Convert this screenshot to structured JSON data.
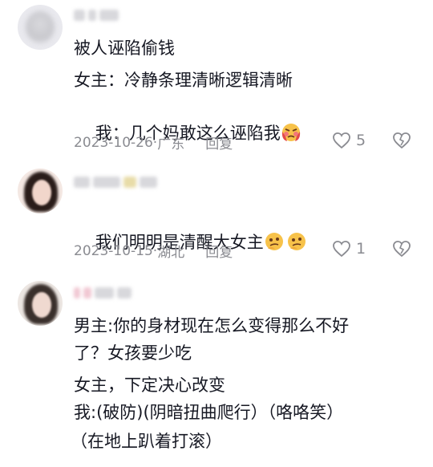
{
  "comments": [
    {
      "lines": [
        "被人诬陷偷钱",
        "女主：冷静条理清晰逻辑清晰",
        "我：几个妈敢这么诬陷我"
      ],
      "date": "2023-10-26",
      "location": "广东",
      "reply_label": "回复",
      "like_count": "5",
      "emoji": "angry-face-emoji"
    },
    {
      "lines": [
        "我们明明是清醒大女主"
      ],
      "date": "2023-10-15",
      "location": "湖北",
      "reply_label": "回复",
      "like_count": "1",
      "emoji": "thinking-face-emoji"
    },
    {
      "lines": [
        "男主:你的身材现在怎么变得那么不好",
        "了？女孩要少吃",
        "女主，下定决心改变",
        "我:(破防)(阴暗扭曲爬行）（咯咯笑）",
        "（在地上趴着打滚）"
      ]
    }
  ],
  "meta_separator": " · ",
  "colors": {
    "text": "#161823",
    "meta": "#8a8b91"
  }
}
